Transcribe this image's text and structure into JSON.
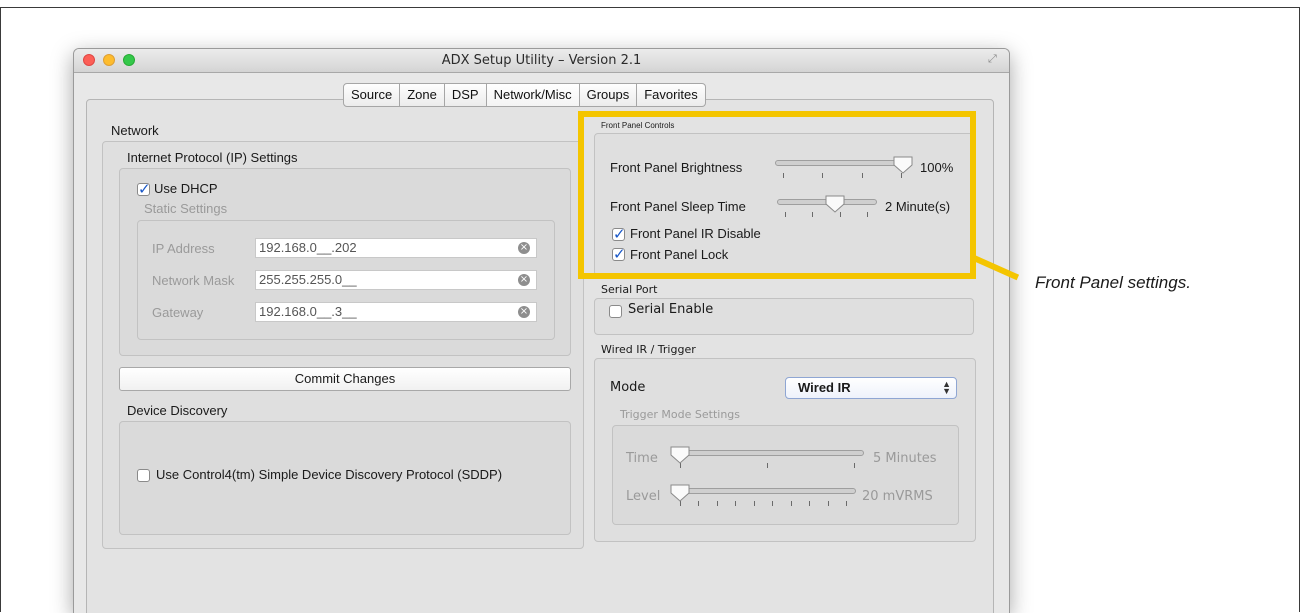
{
  "window": {
    "title": "ADX Setup Utility – Version 2.1"
  },
  "tabs": [
    {
      "label": "Source"
    },
    {
      "label": "Zone"
    },
    {
      "label": "DSP"
    },
    {
      "label": "Network/Misc"
    },
    {
      "label": "Groups"
    },
    {
      "label": "Favorites"
    }
  ],
  "network": {
    "title": "Network",
    "ip_settings_title": "Internet Protocol (IP) Settings",
    "use_dhcp_label": "Use DHCP",
    "use_dhcp_checked": true,
    "static_settings_title": "Static Settings",
    "ip_address_label": "IP Address",
    "ip_address_value": "192.168.0__.202",
    "network_mask_label": "Network Mask",
    "network_mask_value": "255.255.255.0__",
    "gateway_label": "Gateway",
    "gateway_value": "192.168.0__.3__",
    "commit_button": "Commit Changes"
  },
  "device_discovery": {
    "title": "Device Discovery",
    "sddp_label": "Use Control4(tm) Simple Device Discovery Protocol (SDDP)",
    "sddp_checked": false
  },
  "front_panel": {
    "title": "Front Panel Controls",
    "brightness_label": "Front Panel Brightness",
    "brightness_value": "100%",
    "brightness_level": 1.0,
    "sleep_label": "Front Panel Sleep Time",
    "sleep_value": "2 Minute(s)",
    "sleep_level": 0.6,
    "ir_disable_label": "Front Panel IR Disable",
    "ir_disable_checked": true,
    "lock_label": "Front Panel Lock",
    "lock_checked": true
  },
  "serial_port": {
    "title": "Serial Port",
    "enable_label": "Serial Enable",
    "enable_checked": false
  },
  "wired_ir": {
    "title": "Wired IR / Trigger",
    "mode_label": "Mode",
    "mode_value": "Wired IR",
    "trigger_title": "Trigger Mode Settings",
    "time_label": "Time",
    "time_value": "5 Minutes",
    "time_level": 0.0,
    "level_label": "Level",
    "level_value": "20 mVRMS",
    "level_level": 0.0
  },
  "callout": {
    "text": "Front Panel settings."
  },
  "colors": {
    "highlight": "#f4c500",
    "check": "#1a58c7"
  }
}
